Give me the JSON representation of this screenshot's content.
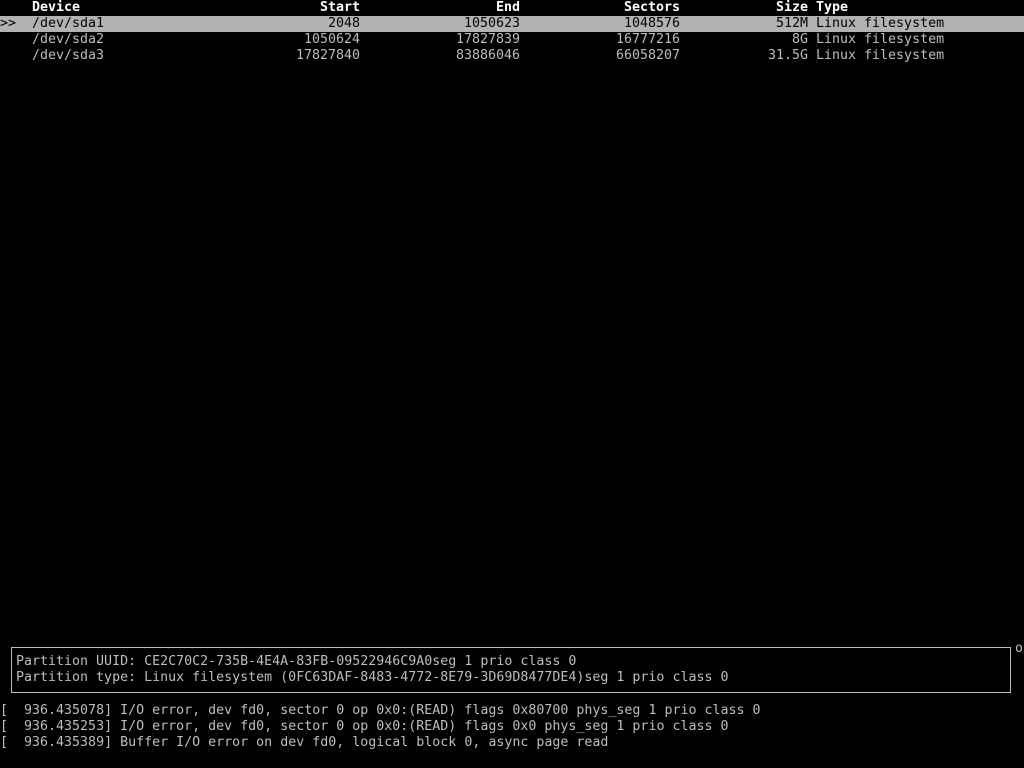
{
  "table": {
    "columns": {
      "device": "Device",
      "start": "Start",
      "end": "End",
      "sectors": "Sectors",
      "size": "Size",
      "type": "Type"
    },
    "rows": [
      {
        "marker": ">>",
        "device": "/dev/sda1",
        "start": "2048",
        "end": "1050623",
        "sectors": "1048576",
        "size": "512M",
        "type": "Linux filesystem",
        "selected": true
      },
      {
        "marker": "",
        "device": "/dev/sda2",
        "start": "1050624",
        "end": "17827839",
        "sectors": "16777216",
        "size": "8G",
        "type": "Linux filesystem",
        "selected": false
      },
      {
        "marker": "",
        "device": "/dev/sda3",
        "start": "17827840",
        "end": "83886046",
        "sectors": "66058207",
        "size": "31.5G",
        "type": "Linux filesystem",
        "selected": false
      }
    ]
  },
  "info": {
    "uuid_line": "Partition UUID: CE2C70C2-735B-4E4A-83FB-09522946C9A0seg 1 prio class 0",
    "type_line": "Partition type: Linux filesystem (0FC63DAF-8483-4772-8E79-3D69D8477DE4)seg 1 prio class 0",
    "corner_char": "o"
  },
  "kernel_log": [
    "[  936.435078] I/O error, dev fd0, sector 0 op 0x0:(READ) flags 0x80700 phys_seg 1 prio class 0",
    "[  936.435253] I/O error, dev fd0, sector 0 op 0x0:(READ) flags 0x0 phys_seg 1 prio class 0",
    "[  936.435389] Buffer I/O error on dev fd0, logical block 0, async page read"
  ],
  "colors": {
    "background": "#000000",
    "text": "#bdbdbd",
    "selected_bg": "#b2b2b2",
    "selected_text": "#000000"
  }
}
